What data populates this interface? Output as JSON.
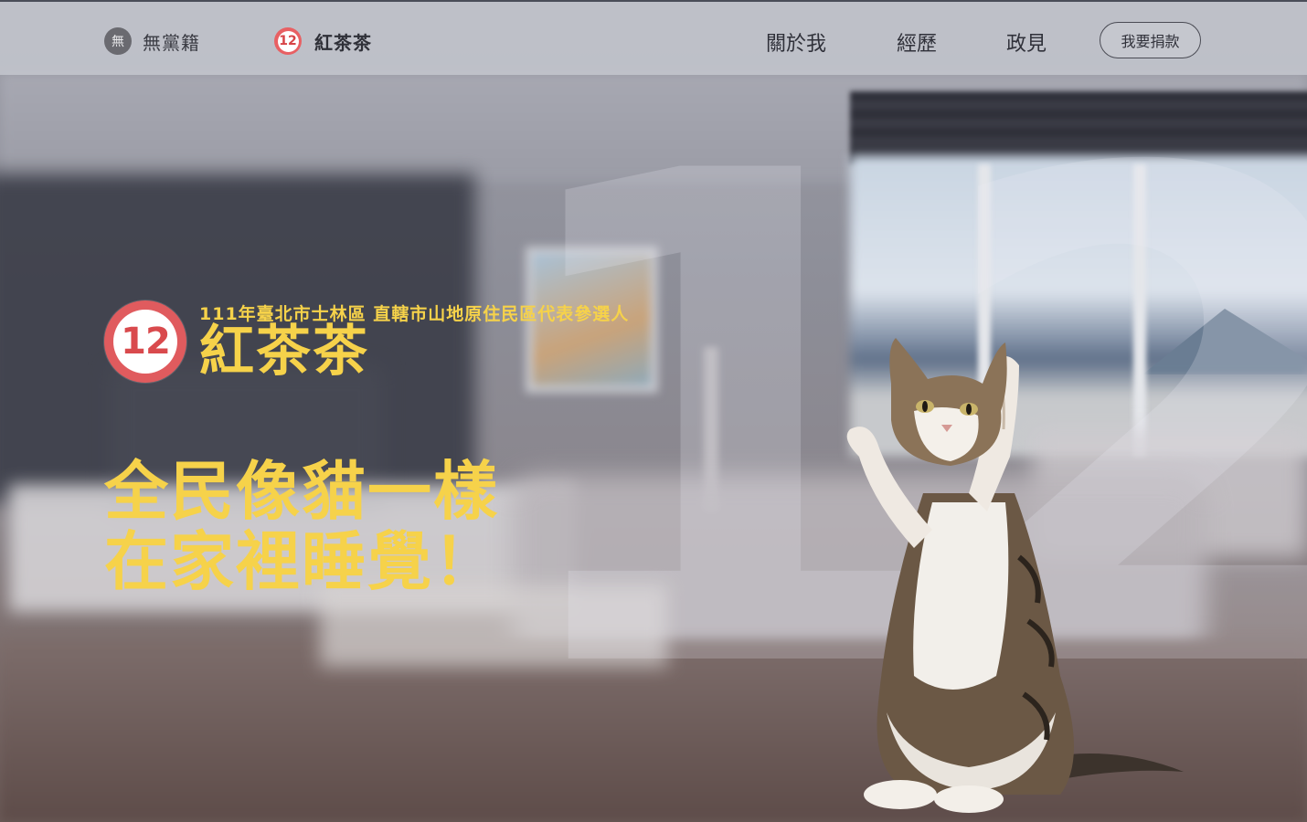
{
  "header": {
    "party_badge_char": "無",
    "party_label": "無黨籍",
    "brand_number": "12",
    "brand_label": "紅茶茶",
    "nav": [
      {
        "label": "關於我"
      },
      {
        "label": "經歷"
      },
      {
        "label": "政見"
      }
    ],
    "donate_label": "我要捐款"
  },
  "hero": {
    "badge_number": "12",
    "subtitle": "111年臺北市士林區 直轄市山地原住民區代表參選人",
    "name": "紅茶茶",
    "slogan": [
      "全民像貓一樣",
      "在家裡睡覺！"
    ],
    "big_number": "12"
  },
  "colors": {
    "accent_yellow": "#f6d24a",
    "badge_red": "#e05b5e"
  }
}
